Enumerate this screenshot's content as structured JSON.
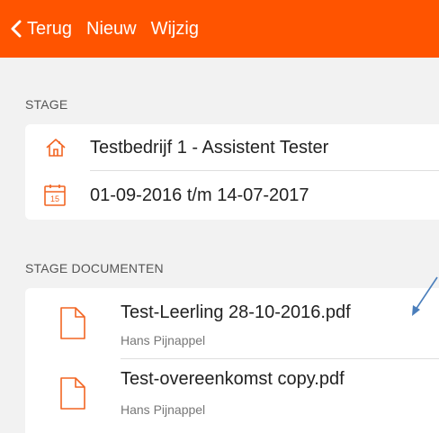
{
  "topbar": {
    "back_label": "Terug",
    "new_label": "Nieuw",
    "edit_label": "Wijzig",
    "bg_color": "#ff5400"
  },
  "stage": {
    "header": "STAGE",
    "company": "Testbedrijf 1 - Assistent Tester",
    "period": "01-09-2016 t/m 14-07-2017",
    "calendar_day": "15",
    "icons": [
      "home-icon",
      "calendar-icon"
    ]
  },
  "documents": {
    "header": "STAGE DOCUMENTEN",
    "items": [
      {
        "title": "Test-Leerling 28-10-2016.pdf",
        "author": "Hans Pijnappel",
        "icon": "document-icon"
      },
      {
        "title": "Test-overeenkomst copy.pdf",
        "author": "Hans Pijnappel",
        "icon": "document-icon"
      }
    ]
  },
  "accent_color": "#f26522",
  "annotation_color": "#4a7ebb"
}
